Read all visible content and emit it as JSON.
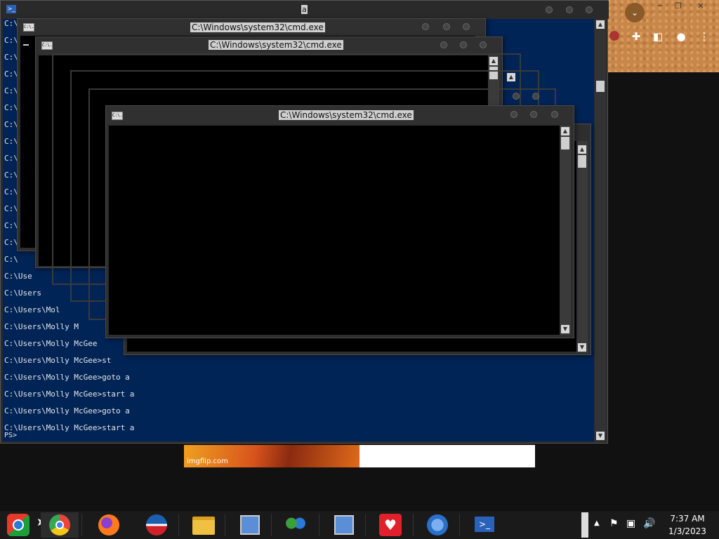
{
  "powershell": {
    "title": "a",
    "lines": [
      "C:\\",
      "C:\\",
      "C:\\",
      "C:\\",
      "C:\\",
      "C:\\",
      "C:\\",
      "C:\\",
      "C:\\",
      "C:\\",
      "C:\\",
      "C:\\",
      "C:\\",
      "C:\\",
      "C:\\",
      "C:\\Use",
      "C:\\Users",
      "C:\\Users\\Mol",
      "C:\\Users\\Molly M",
      "C:\\Users\\Molly McGee",
      "C:\\Users\\Molly McGee>st",
      "C:\\Users\\Molly McGee>goto a",
      "C:\\Users\\Molly McGee>start a",
      "C:\\Users\\Molly McGee>goto a",
      "C:\\Users\\Molly McGee>start a"
    ],
    "prompt": "PS>"
  },
  "cmd_windows": {
    "title": "C:\\Windows\\system32\\cmd.exe",
    "icon_text": "C:\\."
  },
  "meme": {
    "watermark": "imgflip.com"
  },
  "taskbar": {
    "items": [
      {
        "icon": "start-orb-icon",
        "color": "#1a9f3a"
      },
      {
        "icon": "chrome-icon",
        "color": "#e8453c"
      },
      {
        "icon": "firefox-icon",
        "color": "#ff7a1a"
      },
      {
        "icon": "obama-logo-icon",
        "color": "#1b5fae"
      },
      {
        "icon": "file-explorer-icon",
        "color": "#f0c040"
      },
      {
        "icon": "install-disk-icon",
        "color": "#5a8fd8"
      },
      {
        "icon": "network-users-icon",
        "color": "#3aa03a"
      },
      {
        "icon": "install-disk-icon",
        "color": "#5a8fd8"
      },
      {
        "icon": "heartbrand-icon",
        "color": "#e0202a"
      },
      {
        "icon": "world-clock-icon",
        "color": "#2a6fc8"
      },
      {
        "icon": "powershell-icon",
        "color": "#2a62b8"
      }
    ],
    "clock_time": "7:37 AM",
    "clock_date": "1/3/2023"
  },
  "chrome": {
    "colors": {
      "titlebar_bg": "#c8874a"
    }
  }
}
